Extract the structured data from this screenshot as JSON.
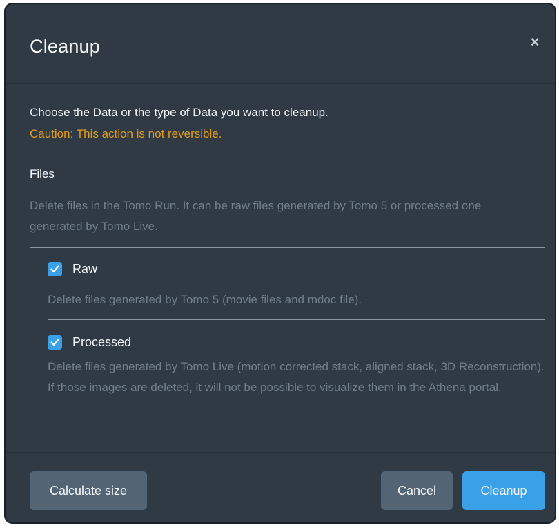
{
  "dialog": {
    "title": "Cleanup",
    "close_label": "×"
  },
  "body": {
    "intro": "Choose the Data or the type of Data you want to cleanup.",
    "caution": "Caution: This action is not reversible.",
    "section": {
      "title": "Files",
      "description": "Delete files in the Tomo Run. It can be raw files generated by Tomo 5 or processed one generated by Tomo Live."
    },
    "options": [
      {
        "label": "Raw",
        "checked": true,
        "description": "Delete files generated by Tomo 5 (movie files and mdoc file)."
      },
      {
        "label": "Processed",
        "checked": true,
        "description": "Delete files generated by Tomo Live (motion corrected stack, aligned stack, 3D Reconstruction). If those images are deleted, it will not be possible to visualize them in the Athena portal."
      }
    ]
  },
  "footer": {
    "calculate_label": "Calculate size",
    "cancel_label": "Cancel",
    "cleanup_label": "Cleanup"
  },
  "colors": {
    "modal_bg": "#2f3a45",
    "accent": "#3aa0e8",
    "caution": "#e49a19",
    "secondary_button": "#536575",
    "muted_text": "#717f8b"
  },
  "icons": {
    "close": "close-icon",
    "checkbox": "checkmark-icon"
  }
}
